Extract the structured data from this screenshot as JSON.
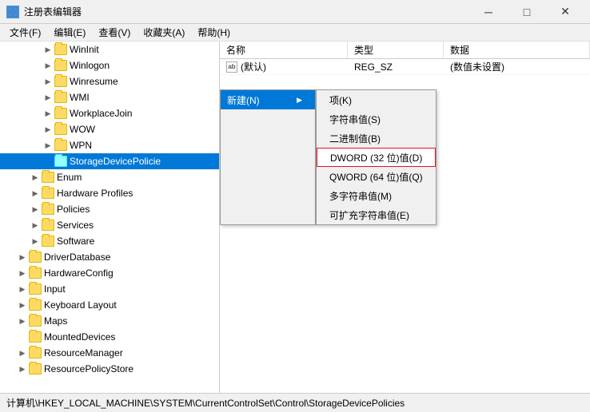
{
  "window": {
    "title": "注册表编辑器",
    "icon": "regedit-icon"
  },
  "titlebar": {
    "minimize": "─",
    "maximize": "□",
    "close": "✕"
  },
  "menubar": {
    "items": [
      {
        "label": "文件(F)"
      },
      {
        "label": "编辑(E)"
      },
      {
        "label": "查看(V)"
      },
      {
        "label": "收藏夹(A)"
      },
      {
        "label": "帮助(H)"
      }
    ]
  },
  "tree": {
    "items": [
      {
        "label": "WinInit",
        "indent": 2,
        "expanded": false,
        "selected": false
      },
      {
        "label": "Winlogon",
        "indent": 2,
        "expanded": false,
        "selected": false
      },
      {
        "label": "Winresume",
        "indent": 2,
        "expanded": false,
        "selected": false
      },
      {
        "label": "WMI",
        "indent": 2,
        "expanded": false,
        "selected": false
      },
      {
        "label": "WorkplaceJoin",
        "indent": 2,
        "expanded": false,
        "selected": false
      },
      {
        "label": "WOW",
        "indent": 2,
        "expanded": false,
        "selected": false
      },
      {
        "label": "WPN",
        "indent": 2,
        "expanded": false,
        "selected": false
      },
      {
        "label": "StorageDevicePolicie",
        "indent": 2,
        "expanded": false,
        "selected": true
      },
      {
        "label": "Enum",
        "indent": 1,
        "expanded": false,
        "selected": false
      },
      {
        "label": "Hardware Profiles",
        "indent": 1,
        "expanded": false,
        "selected": false
      },
      {
        "label": "Policies",
        "indent": 1,
        "expanded": false,
        "selected": false
      },
      {
        "label": "Services",
        "indent": 1,
        "expanded": false,
        "selected": false
      },
      {
        "label": "Software",
        "indent": 1,
        "expanded": false,
        "selected": false
      },
      {
        "label": "DriverDatabase",
        "indent": 0,
        "expanded": false,
        "selected": false
      },
      {
        "label": "HardwareConfig",
        "indent": 0,
        "expanded": false,
        "selected": false
      },
      {
        "label": "Input",
        "indent": 0,
        "expanded": false,
        "selected": false
      },
      {
        "label": "Keyboard Layout",
        "indent": 0,
        "expanded": false,
        "selected": false
      },
      {
        "label": "Maps",
        "indent": 0,
        "expanded": false,
        "selected": false
      },
      {
        "label": "MountedDevices",
        "indent": 0,
        "expanded": false,
        "selected": false
      },
      {
        "label": "ResourceManager",
        "indent": 0,
        "expanded": false,
        "selected": false
      },
      {
        "label": "ResourcePolicyStore",
        "indent": 0,
        "expanded": false,
        "selected": false
      }
    ]
  },
  "table": {
    "columns": [
      {
        "label": "名称"
      },
      {
        "label": "类型"
      },
      {
        "label": "数据"
      }
    ],
    "rows": [
      {
        "name": "(默认)",
        "type": "REG_SZ",
        "data": "(数值未设置)",
        "icon": "ab"
      }
    ]
  },
  "context_menu": {
    "new_label": "新建(N)",
    "arrow": "▶",
    "submenu_items": [
      {
        "label": "项(K)",
        "highlighted": false
      },
      {
        "label": "字符串值(S)",
        "highlighted": false
      },
      {
        "label": "二进制值(B)",
        "highlighted": false
      },
      {
        "label": "DWORD (32 位)值(D)",
        "highlighted": true
      },
      {
        "label": "QWORD (64 位)值(Q)",
        "highlighted": false
      },
      {
        "label": "多字符串值(M)",
        "highlighted": false
      },
      {
        "label": "可扩充字符串值(E)",
        "highlighted": false
      }
    ]
  },
  "statusbar": {
    "text": "计算机\\HKEY_LOCAL_MACHINE\\SYSTEM\\CurrentControlSet\\Control\\StorageDevicePolicies"
  }
}
